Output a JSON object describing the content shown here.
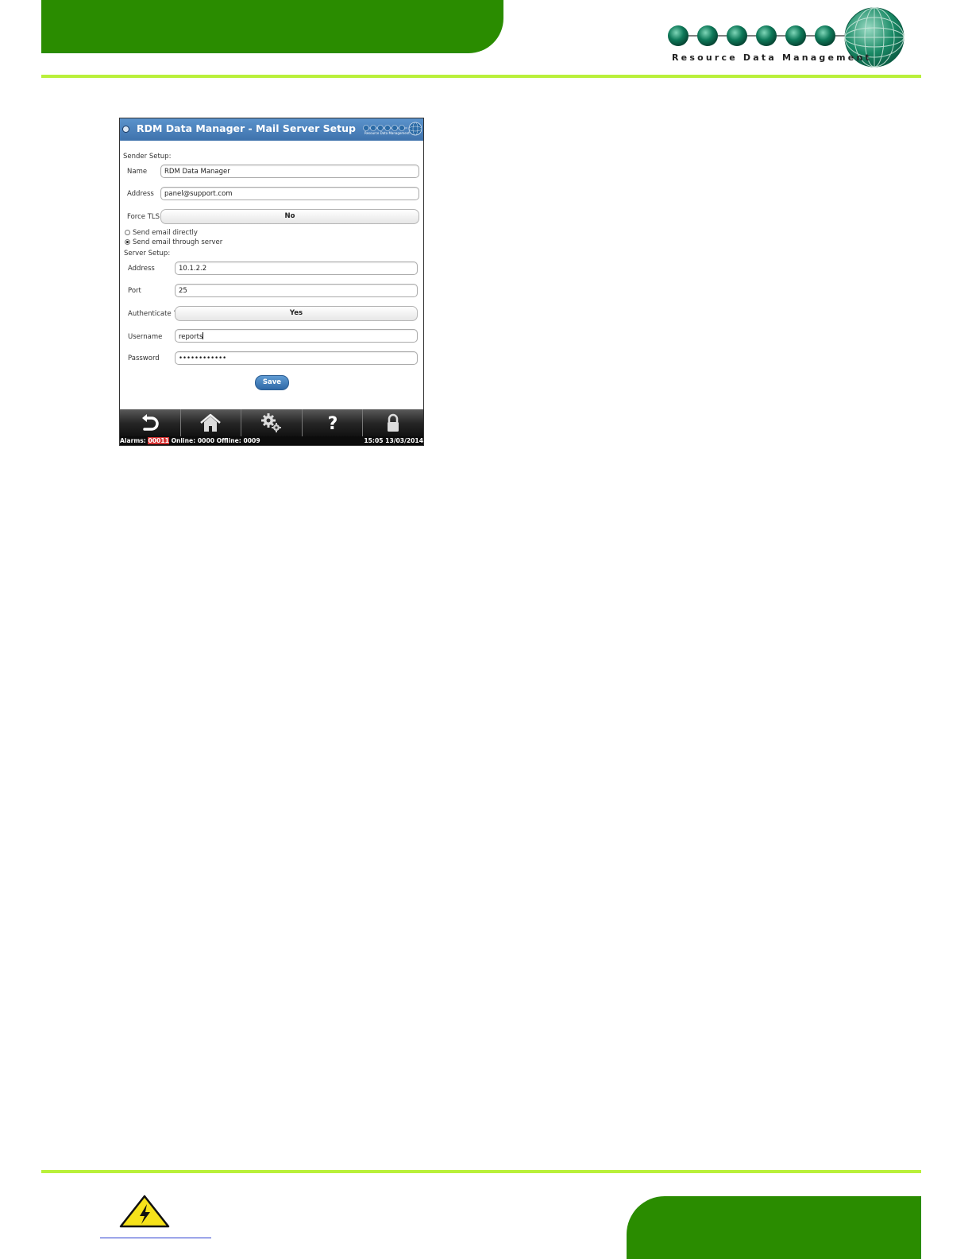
{
  "logo": {
    "company_name": "Resource Data Management"
  },
  "app": {
    "title": "RDM Data Manager - Mail Server Setup",
    "title_logo_text": "Resource Data Management",
    "sender_setup": {
      "section_label": "Sender Setup:",
      "name_label": "Name",
      "name_value": "RDM Data Manager",
      "address_label": "Address",
      "address_value": "panel@support.com",
      "force_tls_label": "Force TLS",
      "force_tls_value": "No"
    },
    "delivery_options": [
      {
        "label": "Send email directly",
        "selected": false
      },
      {
        "label": "Send email through server",
        "selected": true
      }
    ],
    "server_setup": {
      "section_label": "Server Setup:",
      "address_label": "Address",
      "address_value": "10.1.2.2",
      "port_label": "Port",
      "port_value": "25",
      "authenticate_label": "Authenticate ?",
      "authenticate_value": "Yes",
      "username_label": "Username",
      "username_value": "reports",
      "password_label": "Password",
      "password_value": "••••••••••••"
    },
    "save_label": "Save",
    "toolbar": [
      "back-icon",
      "home-icon",
      "settings-icon",
      "help-icon",
      "lock-icon"
    ],
    "status": {
      "alarms_label": "Alarms:",
      "alarms_count": "00011",
      "online_label": "Online:",
      "online_count": "0000",
      "offline_label": "Offline:",
      "offline_count": "0009",
      "time": "15:05",
      "date": "13/03/2014"
    },
    "colors": {
      "brand_green": "#2a8c00",
      "rule_lime": "#b9f03a",
      "title_blue": "#4a80bb",
      "alarm_red": "#d43131"
    }
  }
}
